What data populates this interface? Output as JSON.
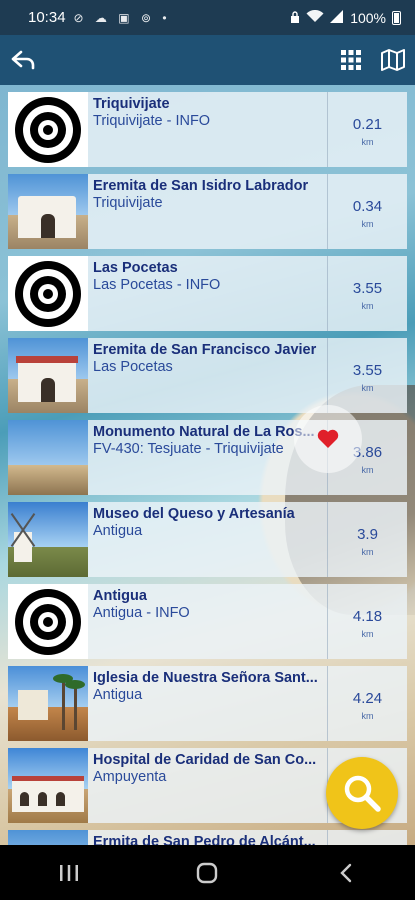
{
  "status_bar": {
    "time": "10:34",
    "notif_icons": "⊘ ☁ ▣ ⊚ •",
    "battery": "100%"
  },
  "toolbar": {
    "back_icon": "back-arrow-icon",
    "grid_icon": "grid-icon",
    "map_icon": "map-icon"
  },
  "items": [
    {
      "title": "Triquivijate",
      "subtitle": "Triquivijate - INFO",
      "distance": "0.21",
      "unit": "km",
      "thumb": "target"
    },
    {
      "title": "Eremita de San Isidro Labrador",
      "subtitle": "Triquivijate",
      "distance": "0.34",
      "unit": "km",
      "thumb": "chapel"
    },
    {
      "title": "Las Pocetas",
      "subtitle": "Las Pocetas - INFO",
      "distance": "3.55",
      "unit": "km",
      "thumb": "target"
    },
    {
      "title": "Eremita de San Francisco Javier",
      "subtitle": "Las Pocetas",
      "distance": "3.55",
      "unit": "km",
      "thumb": "chapel2"
    },
    {
      "title": "Monumento Natural de La Ros...",
      "subtitle": "FV-430: Tesjuate - Triquivijate",
      "distance": "3.86",
      "unit": "km",
      "thumb": "landscape"
    },
    {
      "title": "Museo del Queso y Artesanía",
      "subtitle": "Antigua",
      "distance": "3.9",
      "unit": "km",
      "thumb": "windmill"
    },
    {
      "title": "Antigua",
      "subtitle": "Antigua - INFO",
      "distance": "4.18",
      "unit": "km",
      "thumb": "target"
    },
    {
      "title": "Iglesia de Nuestra Señora Sant...",
      "subtitle": "Antigua",
      "distance": "4.24",
      "unit": "km",
      "thumb": "church"
    },
    {
      "title": "Hospital de Caridad de San Co...",
      "subtitle": "Ampuyenta",
      "distance": "",
      "unit": "",
      "thumb": "hospital"
    },
    {
      "title": "Ermita de San Pedro de Alcánt...",
      "subtitle": "",
      "distance": "",
      "unit": "",
      "thumb": "chapel"
    }
  ],
  "colors": {
    "toolbar": "#1f5174",
    "title_text": "#1a2f7a",
    "fab": "#f0c419",
    "heart": "#e0202a"
  }
}
